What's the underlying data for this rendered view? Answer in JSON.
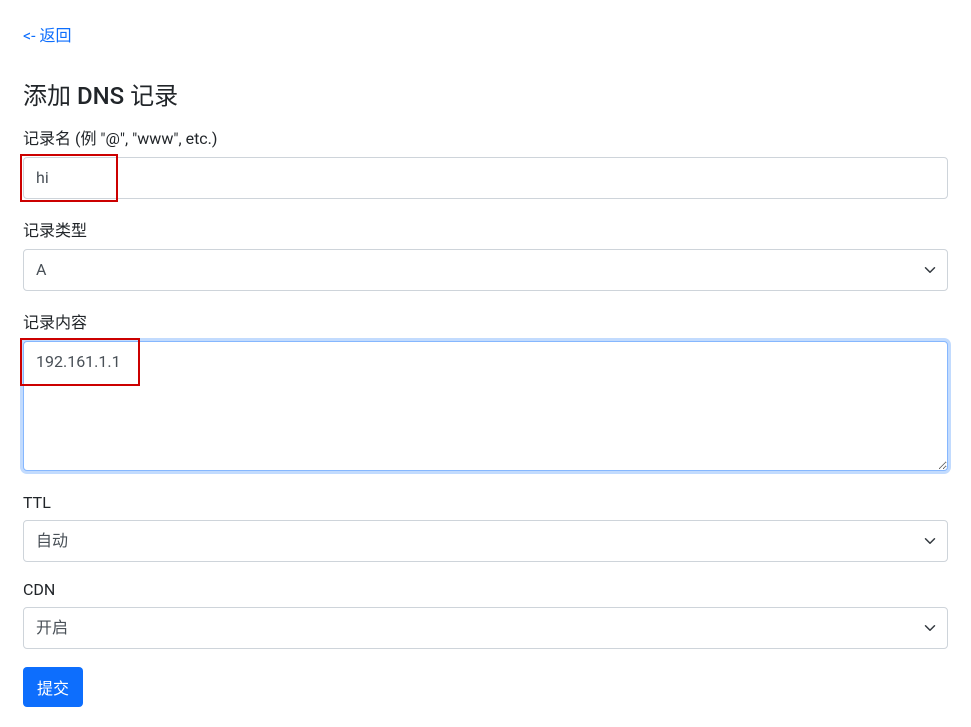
{
  "back_link": "<- 返回",
  "page_title": "添加 DNS 记录",
  "fields": {
    "record_name": {
      "label": "记录名 (例 \"@\", \"www\", etc.)",
      "value": "hi"
    },
    "record_type": {
      "label": "记录类型",
      "value": "A"
    },
    "record_content": {
      "label": "记录内容",
      "value": "192.161.1.1"
    },
    "ttl": {
      "label": "TTL",
      "value": "自动"
    },
    "cdn": {
      "label": "CDN",
      "value": "开启"
    }
  },
  "submit_label": "提交"
}
